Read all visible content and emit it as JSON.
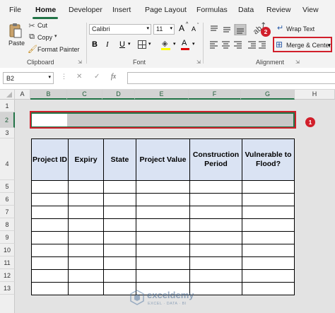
{
  "tabs": [
    "File",
    "Home",
    "Developer",
    "Insert",
    "Page Layout",
    "Formulas",
    "Data",
    "Review",
    "View"
  ],
  "clipboard": {
    "paste": "Paste",
    "cut": "Cut",
    "copy": "Copy",
    "format_painter": "Format Painter",
    "label": "Clipboard"
  },
  "font": {
    "name": "Calibri",
    "size": "11",
    "grow": "A",
    "shrink": "A",
    "bold": "B",
    "italic": "I",
    "underline": "U",
    "font_color": "A",
    "label": "Font"
  },
  "alignment": {
    "wrap_text": "Wrap Text",
    "merge_center": "Merge & Center",
    "label": "Alignment"
  },
  "badges": {
    "one": "1",
    "two": "2"
  },
  "formula_bar": {
    "name_box": "B2",
    "fx": "fx"
  },
  "columns": [
    "A",
    "B",
    "C",
    "D",
    "E",
    "F",
    "G",
    "H"
  ],
  "rows": [
    "1",
    "2",
    "3",
    "4",
    "5",
    "6",
    "7",
    "8",
    "9",
    "10",
    "11",
    "12",
    "13"
  ],
  "table": {
    "headers": [
      "Project ID",
      "Expiry",
      "State",
      "Project Value",
      "Construction Period",
      "Vulnerable to Flood?"
    ],
    "empty_rows": 9
  },
  "watermark": {
    "name": "exceldemy",
    "tagline": "EXCEL · DATA · BI"
  },
  "colors": {
    "accent": "#217346",
    "highlight": "#d11f2b",
    "header_fill": "#dae3f3"
  }
}
